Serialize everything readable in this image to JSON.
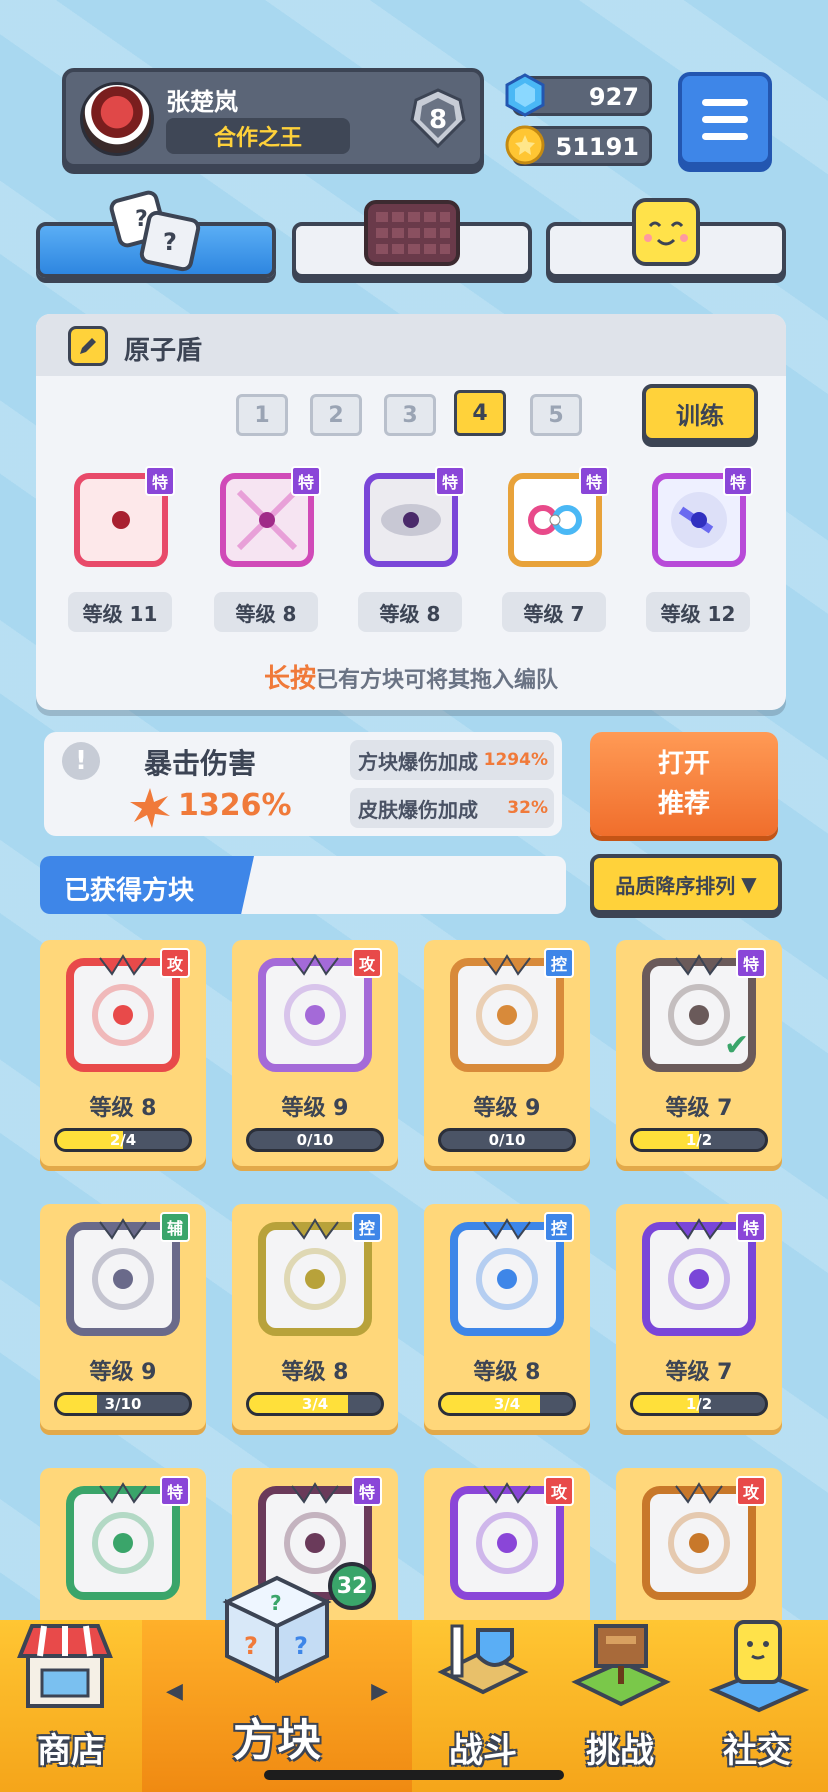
{
  "player": {
    "name": "张楚岚",
    "title": "合作之王",
    "rank": "8"
  },
  "currency": {
    "gems": "927",
    "coins": "51191"
  },
  "squad": {
    "title": "原子盾",
    "numbers": [
      "1",
      "2",
      "3",
      "4",
      "5"
    ],
    "active_number": "4",
    "train_label": "训练",
    "slots": [
      {
        "level": "等级 11",
        "tag": "特",
        "color": "#e84a6a"
      },
      {
        "level": "等级 8",
        "tag": "特",
        "color": "#d04ab8"
      },
      {
        "level": "等级 8",
        "tag": "特",
        "color": "#7a46d8"
      },
      {
        "level": "等级 7",
        "tag": "特",
        "color": "#e8a23a"
      },
      {
        "level": "等级 12",
        "tag": "特",
        "color": "#b84ad8"
      }
    ],
    "hint_highlight": "长按",
    "hint_rest": "已有方块可将其拖入编队"
  },
  "crit": {
    "title": "暴击伤害",
    "value": "1326%",
    "block_bonus_label": "方块爆伤加成",
    "block_bonus_value": "1294%",
    "skin_bonus_label": "皮肤爆伤加成",
    "skin_bonus_value": "32%"
  },
  "recommend": {
    "line1": "打开",
    "line2": "推荐"
  },
  "obtained": {
    "label": "已获得方块",
    "sort_label": "品质降序排列"
  },
  "cards": [
    {
      "level": "等级 8",
      "progress": "2/4",
      "fill": 0.5,
      "tag": "攻",
      "tag_class": "gong",
      "color": "#e84a4a"
    },
    {
      "level": "等级 9",
      "progress": "0/10",
      "fill": 0,
      "tag": "攻",
      "tag_class": "gong",
      "color": "#a46ad8"
    },
    {
      "level": "等级 9",
      "progress": "0/10",
      "fill": 0,
      "tag": "控",
      "tag_class": "kong",
      "color": "#d88a3a"
    },
    {
      "level": "等级 7",
      "progress": "1/2",
      "fill": 0.5,
      "tag": "特",
      "tag_class": "te",
      "color": "#6a5a5a"
    },
    {
      "level": "等级 9",
      "progress": "3/10",
      "fill": 0.3,
      "tag": "辅",
      "tag_class": "fu",
      "color": "#6a6a8a"
    },
    {
      "level": "等级 8",
      "progress": "3/4",
      "fill": 0.75,
      "tag": "控",
      "tag_class": "kong",
      "color": "#b8a23a"
    },
    {
      "level": "等级 8",
      "progress": "3/4",
      "fill": 0.75,
      "tag": "控",
      "tag_class": "kong",
      "color": "#3e86e8"
    },
    {
      "level": "等级 7",
      "progress": "1/2",
      "fill": 0.5,
      "tag": "特",
      "tag_class": "te",
      "color": "#7a46d8"
    },
    {
      "level": "",
      "progress": "",
      "fill": 0,
      "tag": "特",
      "tag_class": "te",
      "color": "#3aa56a"
    },
    {
      "level": "",
      "progress": "",
      "fill": 0,
      "tag": "特",
      "tag_class": "te",
      "color": "#6a3a5a"
    },
    {
      "level": "",
      "progress": "",
      "fill": 0,
      "tag": "攻",
      "tag_class": "gong",
      "color": "#8a46d8"
    },
    {
      "level": "",
      "progress": "",
      "fill": 0,
      "tag": "攻",
      "tag_class": "gong",
      "color": "#c8782a"
    }
  ],
  "nav": {
    "shop": "商店",
    "blocks": "方块",
    "battle": "战斗",
    "challenge": "挑战",
    "social": "社交",
    "blocks_badge": "32"
  }
}
